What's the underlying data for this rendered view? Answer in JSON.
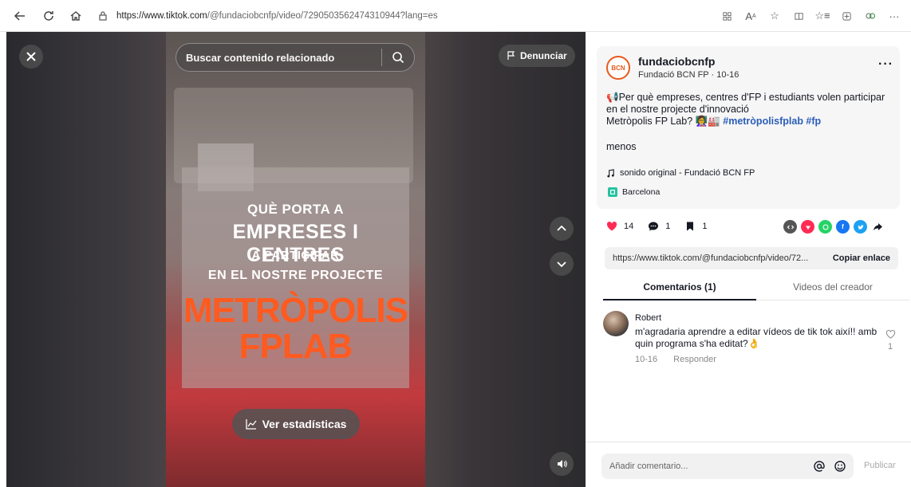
{
  "browser": {
    "url_host": "https://www.tiktok.com",
    "url_path": "/@fundaciobcnfp/video/7290503562474310944?lang=es"
  },
  "video": {
    "search_placeholder": "Buscar contenido relacionado",
    "report_label": "Denunciar",
    "stats_label": "Ver estadísticas",
    "overlay_lines": [
      "QUÈ PORTA A",
      "EMPRESES I CENTRES",
      "A PARTICIPAR",
      "EN EL NOSTRE PROJECTE",
      "METRÒPOLIS",
      "FPLAB"
    ]
  },
  "post": {
    "username": "fundaciobcnfp",
    "nickname_date": "Fundació BCN FP · 10-16",
    "avatar_text": "BCN",
    "description_line1": "📢Per què empreses, centres d'FP i estudiants volen participar en el nostre projecte d'innovació",
    "description_line2": "Metròpolis FP Lab? 👩‍🏫🏭",
    "hashtags": "#metròpolisfplab #fp",
    "menos": "menos",
    "music": "sonido original - Fundació BCN FP",
    "location": "Barcelona"
  },
  "actions": {
    "likes": "14",
    "comments": "1",
    "saves": "1"
  },
  "share": {
    "link": "https://www.tiktok.com/@fundaciobcnfp/video/72...",
    "copy_label": "Copiar enlace"
  },
  "tabs": [
    "Comentarios (1)",
    "Videos del creador"
  ],
  "comments": [
    {
      "name": "Robert",
      "text": "m'agradaria aprendre a editar vídeos de tik tok així!! amb quin programa s'ha editat?👌",
      "date": "10-16",
      "reply": "Responder",
      "likes": "1"
    }
  ],
  "comment_bar": {
    "placeholder": "Añadir comentario...",
    "post_label": "Publicar"
  },
  "colors": {
    "accent_red": "#fe2c55",
    "hashtag_blue": "#2b5db9",
    "title_orange": "#ff5a1f"
  }
}
